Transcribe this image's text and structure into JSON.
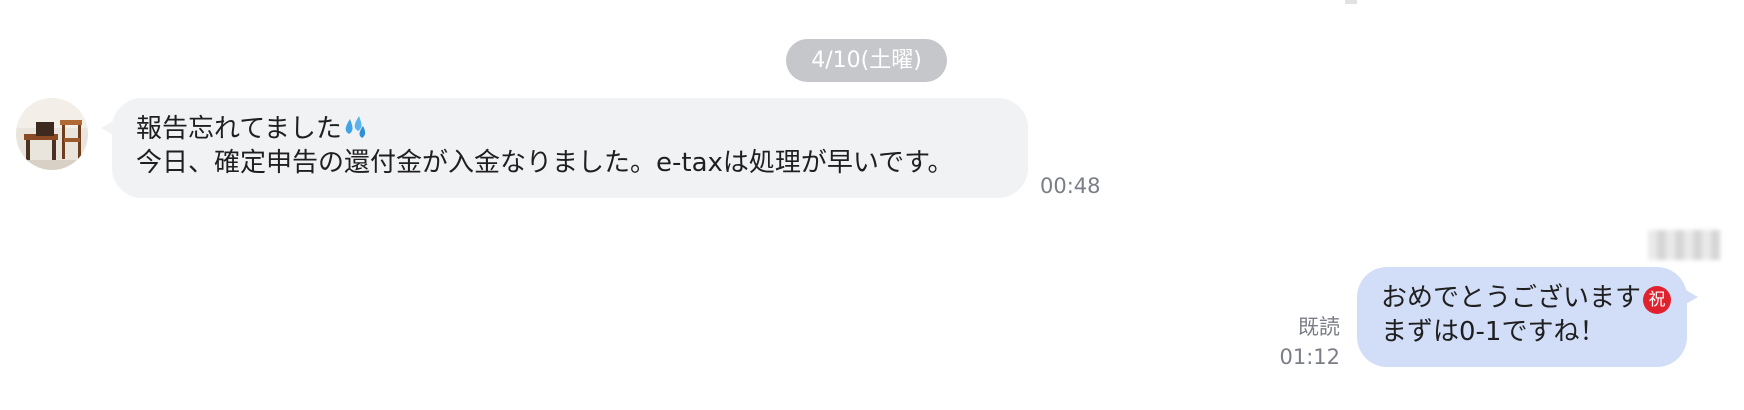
{
  "date_separator": "4/10(土曜)",
  "messages": [
    {
      "direction": "incoming",
      "lines": [
        "報告忘れてました",
        "今日、確定申告の還付金が入金なりました。e-taxは処理が早いです。"
      ],
      "emoji": "sweat-droplets",
      "time": "00:48"
    },
    {
      "direction": "outgoing",
      "lines": [
        "おめでとうございます",
        "まずは0-1ですね！"
      ],
      "emoji_text": "祝",
      "read_label": "既読",
      "time": "01:12"
    }
  ],
  "colors": {
    "incoming_bubble": "#f1f2f4",
    "outgoing_bubble": "#d2def7",
    "date_pill": "#c5c7cb",
    "meta_text": "#7b7e86",
    "iwai_badge": "#e0222e"
  }
}
